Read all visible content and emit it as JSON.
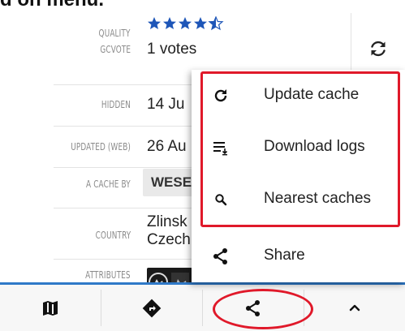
{
  "top_fragment": "d on menu.",
  "cache_details": {
    "quality_label": "QUALITY",
    "gcvote_label": "GCVOTE",
    "rating_stars": 4.5,
    "votes": "1 votes",
    "hidden_label": "HIDDEN",
    "hidden_value": "14 Ju",
    "updated_label": "UPDATED (WEB)",
    "updated_value": "26 Au",
    "cache_by_label": "A CACHE BY",
    "cache_by_value": "WESE",
    "country_label": "COUNTRY",
    "country_line1": "Zlinsk",
    "country_line2": "Czech",
    "attributes_label": "ATTRIBUTES"
  },
  "context_menu": {
    "items": [
      {
        "label": "Update cache",
        "icon": "refresh-icon"
      },
      {
        "label": "Download logs",
        "icon": "download-logs-icon"
      },
      {
        "label": "Nearest caches",
        "icon": "search-icon"
      },
      {
        "label": "Share",
        "icon": "share-icon"
      }
    ]
  },
  "bottom_bar": {
    "items": [
      {
        "icon": "map-icon"
      },
      {
        "icon": "navigate-icon"
      },
      {
        "icon": "share-icon"
      },
      {
        "icon": "chevron-up-icon"
      }
    ]
  },
  "colors": {
    "accent_blue": "#2f79c8",
    "star_blue": "#1e56b8",
    "highlight_red": "#e0192a"
  }
}
